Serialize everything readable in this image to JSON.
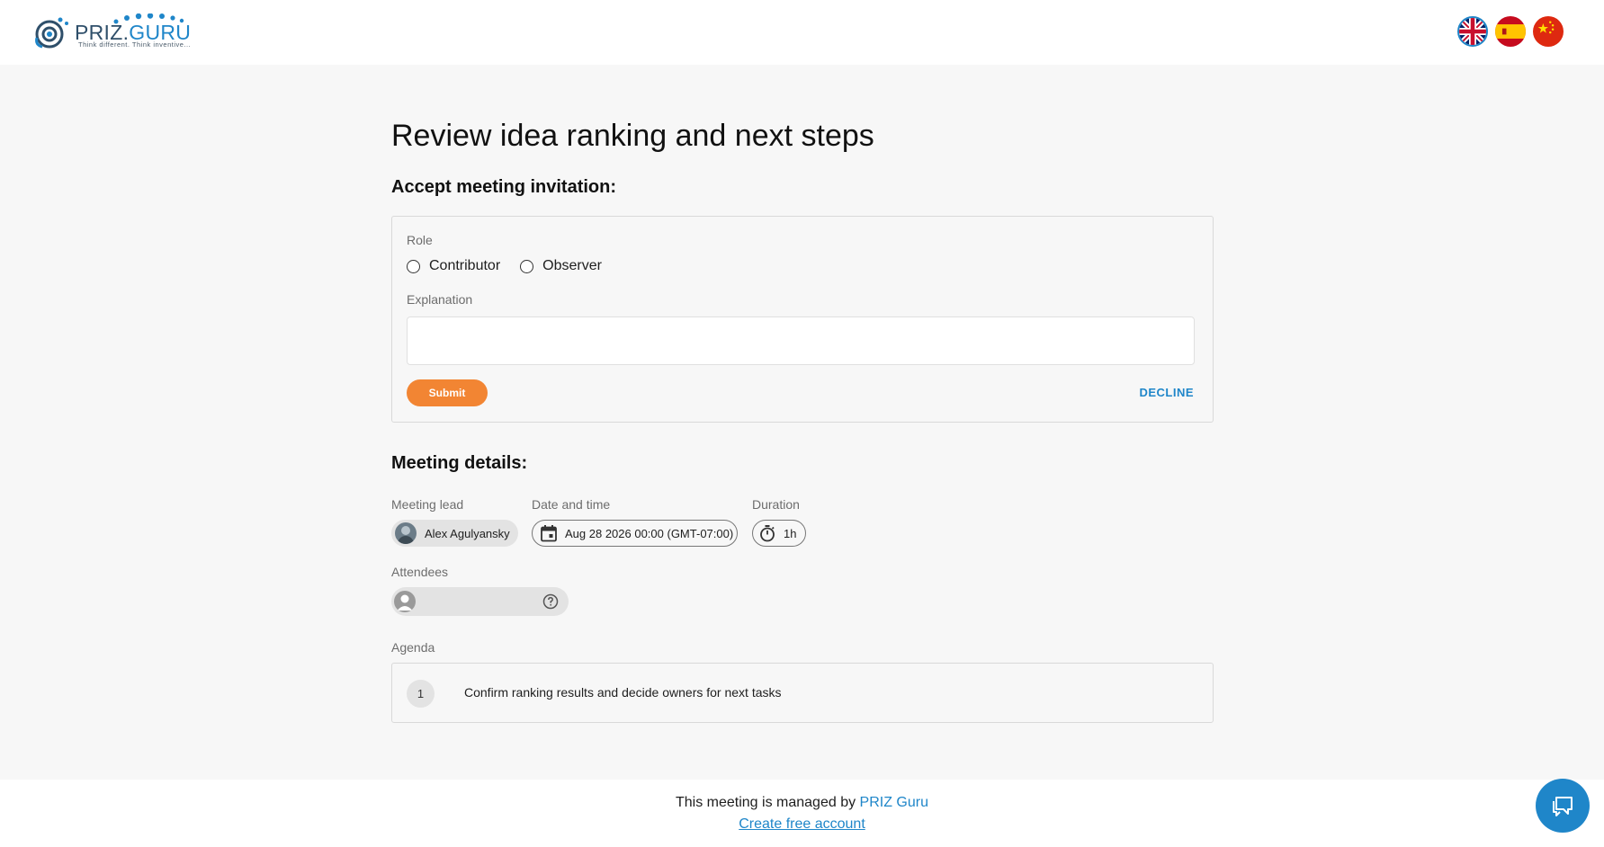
{
  "header": {
    "logo_text_main": "PRIZ.",
    "logo_text_accent": "GURU",
    "logo_tagline": "Think different. Think inventive...",
    "languages": [
      {
        "code": "en",
        "name": "English",
        "selected": true
      },
      {
        "code": "es",
        "name": "Spanish",
        "selected": false
      },
      {
        "code": "zh",
        "name": "Chinese",
        "selected": false
      }
    ]
  },
  "page": {
    "title": "Review idea ranking and next steps",
    "invitation_heading": "Accept meeting invitation:"
  },
  "form": {
    "role_label": "Role",
    "roles": [
      "Contributor",
      "Observer"
    ],
    "explanation_label": "Explanation",
    "explanation_value": "",
    "submit_label": "Submit",
    "decline_label": "DECLINE"
  },
  "details": {
    "heading": "Meeting details:",
    "lead_label": "Meeting lead",
    "lead_name": "Alex Agulyansky",
    "datetime_label": "Date and time",
    "datetime_value": "Aug 28 2026 00:00 (GMT-07:00)",
    "duration_label": "Duration",
    "duration_value": "1h",
    "attendees_label": "Attendees",
    "agenda_label": "Agenda",
    "agenda_items": [
      {
        "number": "1",
        "text": "Confirm ranking results and decide owners for next tasks"
      }
    ]
  },
  "footer": {
    "managed_text": "This meeting is managed by ",
    "managed_link": "PRIZ Guru",
    "create_account": "Create free account"
  },
  "colors": {
    "accent_blue": "#1f86c9",
    "submit_orange": "#f28533",
    "background": "#f7f7f7"
  }
}
